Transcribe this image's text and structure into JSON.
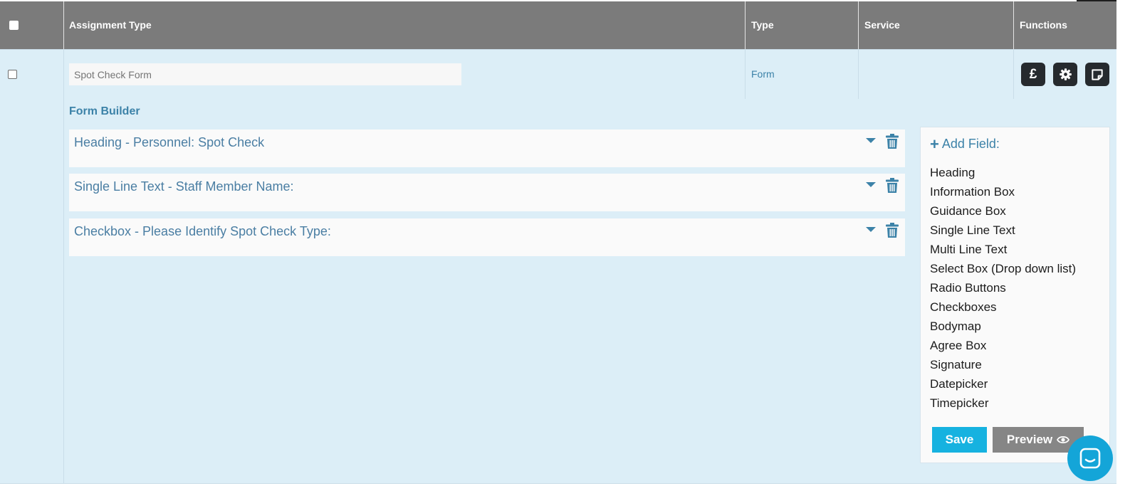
{
  "table": {
    "columns": [
      "Assignment Type",
      "Type",
      "Service",
      "Functions"
    ],
    "row": {
      "assignment_value": "",
      "assignment_placeholder": "Spot Check Form",
      "type": "Form",
      "service": "",
      "functions": [
        {
          "icon": "pound-icon",
          "glyph": "£"
        },
        {
          "icon": "gear-icon"
        },
        {
          "icon": "note-icon"
        }
      ]
    }
  },
  "form_builder": {
    "title": "Form Builder",
    "fields": [
      {
        "label": "Heading - Personnel: Spot Check"
      },
      {
        "label": "Single Line Text - Staff Member Name:"
      },
      {
        "label": "Checkbox - Please Identify Spot Check Type:"
      }
    ],
    "add_field": {
      "title": "Add Field:",
      "options": [
        "Heading",
        "Information Box",
        "Guidance Box",
        "Single Line Text",
        "Multi Line Text",
        "Select Box (Drop down list)",
        "Radio Buttons",
        "Checkboxes",
        "Bodymap",
        "Agree Box",
        "Signature",
        "Datepicker",
        "Timepicker"
      ]
    },
    "save_label": "Save",
    "preview_label": "Preview"
  },
  "colors": {
    "header_bg": "#7b7b7b",
    "row_bg": "#dceef7",
    "accent": "#3c82a8",
    "save_button": "#16b2e0",
    "preview_button": "#868686",
    "chat_launcher": "#14a5d8"
  }
}
